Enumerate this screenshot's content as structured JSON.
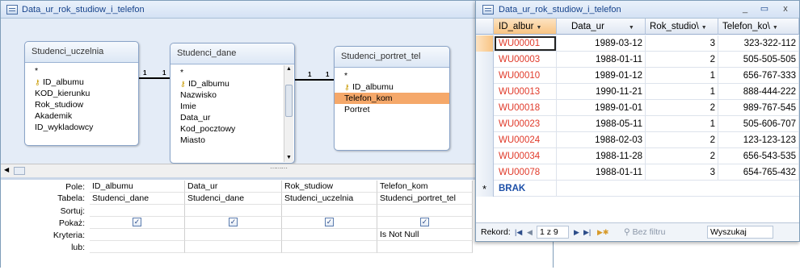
{
  "query_window": {
    "title": "Data_ur_rok_studiow_i_telefon",
    "tables": [
      {
        "name": "Studenci_uczelnia",
        "fields": [
          "*",
          "ID_albumu",
          "KOD_kierunku",
          "Rok_studiow",
          "Akademik",
          "ID_wykladowcy"
        ]
      },
      {
        "name": "Studenci_dane",
        "fields": [
          "*",
          "ID_albumu",
          "Nazwisko",
          "Imie",
          "Data_ur",
          "Kod_pocztowy",
          "Miasto"
        ]
      },
      {
        "name": "Studenci_portret_tel",
        "fields": [
          "*",
          "ID_albumu",
          "Telefon_kom",
          "Portret"
        ]
      }
    ],
    "join_labels": [
      "1",
      "1",
      "1",
      "1"
    ],
    "grid": {
      "row_labels": [
        "Pole:",
        "Tabela:",
        "Sortuj:",
        "Pokaż:",
        "Kryteria:",
        "lub:"
      ],
      "columns": [
        {
          "field": "ID_albumu",
          "table": "Studenci_dane",
          "sort": "",
          "show": true,
          "criteria": ""
        },
        {
          "field": "Data_ur",
          "table": "Studenci_dane",
          "sort": "",
          "show": true,
          "criteria": ""
        },
        {
          "field": "Rok_studiow",
          "table": "Studenci_uczelnia",
          "sort": "",
          "show": true,
          "criteria": ""
        },
        {
          "field": "Telefon_kom",
          "table": "Studenci_portret_tel",
          "sort": "",
          "show": true,
          "criteria": "Is Not Null"
        }
      ]
    }
  },
  "datasheet": {
    "title": "Data_ur_rok_studiow_i_telefon",
    "columns": [
      "ID_albur",
      "Data_ur",
      "Rok_studio\\",
      "Telefon_ko\\"
    ],
    "rows": [
      [
        "WU00001",
        "1989-03-12",
        "3",
        "323-322-112"
      ],
      [
        "WU00003",
        "1988-01-11",
        "2",
        "505-505-505"
      ],
      [
        "WU00010",
        "1989-01-12",
        "1",
        "656-767-333"
      ],
      [
        "WU00013",
        "1990-11-21",
        "1",
        "888-444-222"
      ],
      [
        "WU00018",
        "1989-01-01",
        "2",
        "989-767-545"
      ],
      [
        "WU00023",
        "1988-05-11",
        "1",
        "505-606-707"
      ],
      [
        "WU00024",
        "1988-02-03",
        "2",
        "123-123-123"
      ],
      [
        "WU00034",
        "1988-11-28",
        "2",
        "656-543-535"
      ],
      [
        "WU00078",
        "1988-01-11",
        "3",
        "654-765-432"
      ]
    ],
    "new_row_marker": "*",
    "new_row_text": "BRAK",
    "nav": {
      "label": "Rekord:",
      "position": "1 z 9",
      "filter_label": "Bez filtru",
      "search_placeholder": "Wyszukaj"
    },
    "window_buttons": [
      "_",
      "▭",
      "x"
    ]
  }
}
